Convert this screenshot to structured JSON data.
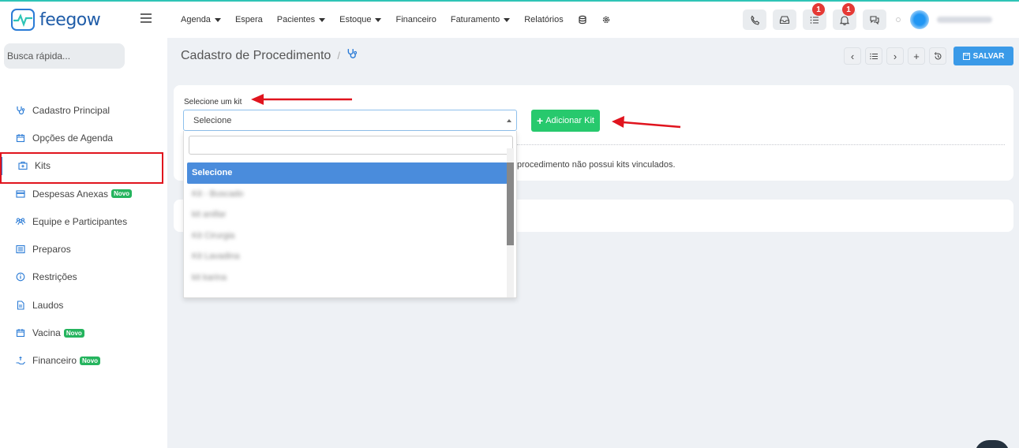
{
  "app": {
    "logo_text": "feegow"
  },
  "nav": {
    "items": [
      {
        "label": "Agenda",
        "dropdown": true
      },
      {
        "label": "Espera",
        "dropdown": false
      },
      {
        "label": "Pacientes",
        "dropdown": true
      },
      {
        "label": "Estoque",
        "dropdown": true
      },
      {
        "label": "Financeiro",
        "dropdown": false
      },
      {
        "label": "Faturamento",
        "dropdown": true
      },
      {
        "label": "Relatórios",
        "dropdown": false
      }
    ],
    "notifications": {
      "tasks_count": "1",
      "alerts_count": "1"
    }
  },
  "sidebar": {
    "search_placeholder": "Busca rápida...",
    "items": [
      {
        "label": "Cadastro Principal",
        "icon": "stethoscope-icon",
        "novo": ""
      },
      {
        "label": "Opções de Agenda",
        "icon": "calendar-icon",
        "novo": ""
      },
      {
        "label": "Kits",
        "icon": "kit-icon",
        "novo": ""
      },
      {
        "label": "Despesas Anexas",
        "icon": "credit-card-icon",
        "novo": "Novo"
      },
      {
        "label": "Equipe e Participantes",
        "icon": "team-icon",
        "novo": ""
      },
      {
        "label": "Preparos",
        "icon": "list-icon",
        "novo": ""
      },
      {
        "label": "Restrições",
        "icon": "info-icon",
        "novo": ""
      },
      {
        "label": "Laudos",
        "icon": "document-icon",
        "novo": ""
      },
      {
        "label": "Vacina",
        "icon": "calendar-icon",
        "novo": "Novo"
      },
      {
        "label": "Financeiro",
        "icon": "hand-money-icon",
        "novo": "Novo"
      }
    ],
    "active_index": 2
  },
  "page": {
    "title": "Cadastro de Procedimento",
    "separator": "/",
    "save_label": "SALVAR"
  },
  "kit_form": {
    "label": "Selecione um kit",
    "selected_value": "Selecione",
    "add_button_label": "Adicionar Kit",
    "empty_message": "procedimento não possui kits vinculados.",
    "options": [
      {
        "label": "Selecione",
        "blurred": false
      },
      {
        "label": "Kit - Buscado",
        "blurred": true
      },
      {
        "label": "kit anillar",
        "blurred": true
      },
      {
        "label": "Kit Cirurgia",
        "blurred": true
      },
      {
        "label": "Kit Lavadina",
        "blurred": true
      },
      {
        "label": "kit karina",
        "blurred": true
      }
    ]
  },
  "colors": {
    "brand_blue": "#2a7bd6",
    "save_blue": "#3a9ae8",
    "add_green": "#27c96d",
    "novo_green": "#25b45e",
    "badge_red": "#e53935",
    "annotation_red": "#e0141e"
  }
}
